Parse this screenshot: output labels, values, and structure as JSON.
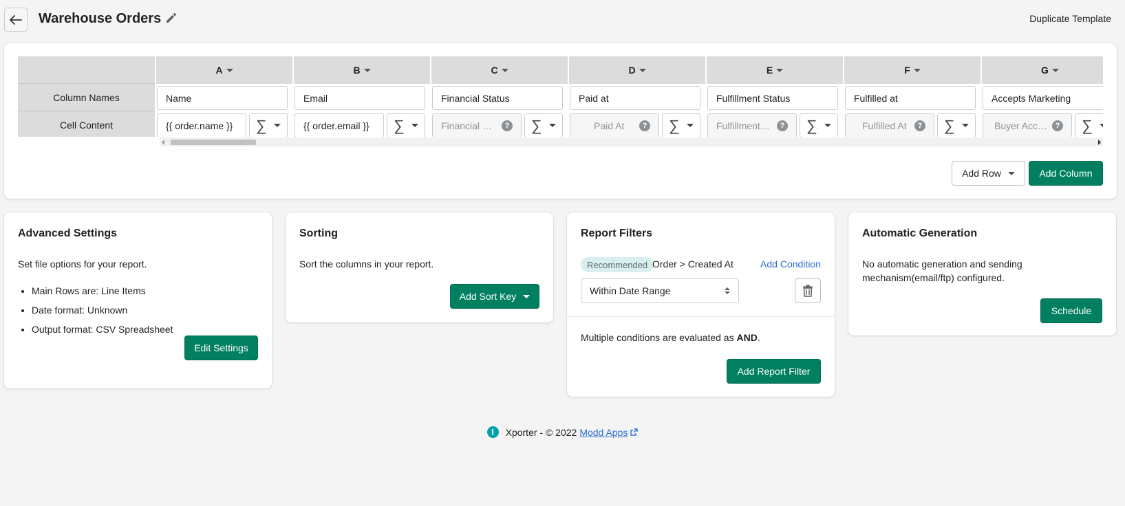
{
  "header": {
    "title": "Warehouse Orders",
    "duplicate_label": "Duplicate Template"
  },
  "grid": {
    "row_headers": [
      "",
      "Column Names",
      "Cell Content"
    ],
    "columns": [
      {
        "letter": "A",
        "name": "Name",
        "content": "{{ order.name }}",
        "placeholder": false
      },
      {
        "letter": "B",
        "name": "Email",
        "content": "{{ order.email }}",
        "placeholder": false
      },
      {
        "letter": "C",
        "name": "Financial Status",
        "content": "Financial …",
        "placeholder": true
      },
      {
        "letter": "D",
        "name": "Paid at",
        "content": "Paid At",
        "placeholder": true
      },
      {
        "letter": "E",
        "name": "Fulfillment Status",
        "content": "Fulfillment…",
        "placeholder": true
      },
      {
        "letter": "F",
        "name": "Fulfilled at",
        "content": "Fulfilled At",
        "placeholder": true
      },
      {
        "letter": "G",
        "name": "Accepts Marketing",
        "content": "Buyer Acc…",
        "placeholder": true
      }
    ],
    "sigma_symbol": "∑",
    "help_symbol": "?",
    "add_row_label": "Add Row",
    "add_column_label": "Add Column"
  },
  "advanced": {
    "title": "Advanced Settings",
    "description": "Set file options for your report.",
    "items": [
      "Main Rows are: Line Items",
      "Date format: Unknown",
      "Output format: CSV Spreadsheet"
    ],
    "button": "Edit Settings"
  },
  "sorting": {
    "title": "Sorting",
    "description": "Sort the columns in your report.",
    "button": "Add Sort Key"
  },
  "filters": {
    "title": "Report Filters",
    "badge": "Recommended",
    "condition_label": "Order > Created At",
    "add_condition": "Add Condition",
    "select_value": "Within Date Range",
    "and_prefix": "Multiple conditions are evaluated as ",
    "and_word": "AND",
    "and_suffix": ".",
    "button": "Add Report Filter"
  },
  "autogen": {
    "title": "Automatic Generation",
    "description": "No automatic generation and sending mechanism(email/ftp) configured.",
    "button": "Schedule"
  },
  "footer": {
    "info_symbol": "i",
    "text": "Xporter - © 2022",
    "link": "Modd Apps"
  },
  "colors": {
    "primary": "#008060",
    "link": "#2c6ecb",
    "info": "#00a0ac",
    "badge_bg": "#d9efef"
  }
}
